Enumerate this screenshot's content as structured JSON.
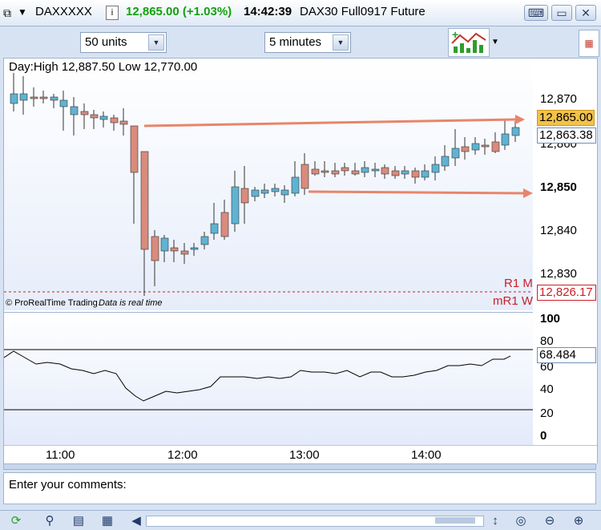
{
  "header": {
    "symbol": "DAXXXXX",
    "price": "12,865.00 (+1.03%)",
    "time": "14:42:39",
    "instrument": "DAX30 Full0917 Future",
    "price_color": "#13a10e"
  },
  "toolbar": {
    "units_value": "50 units",
    "timeframe_value": "5 minutes"
  },
  "chart": {
    "day_info": "Day:High 12,887.50 Low 12,770.00",
    "watermark": "© ProRealTime Trading",
    "realtime_note": "Data is real time",
    "r1_label": "R1 M",
    "mr1_label": "mR1 W",
    "price_labels": [
      "12,870",
      "12,860",
      "12,850",
      "12,840",
      "12,830"
    ],
    "current_price_tag": "12,865.00",
    "last_tag": "12,863.38",
    "pivot_tag": "12,826.17",
    "up_color": "#5fb3d2",
    "down_color": "#d98b7c",
    "arrow_color": "#e8856a"
  },
  "indicator": {
    "labels": [
      "100",
      "80",
      "60",
      "40",
      "20",
      "0"
    ],
    "value_tag": "68.484"
  },
  "time_axis": [
    "11:00",
    "12:00",
    "13:00",
    "14:00"
  ],
  "comments": {
    "placeholder": "Enter your comments:"
  }
}
